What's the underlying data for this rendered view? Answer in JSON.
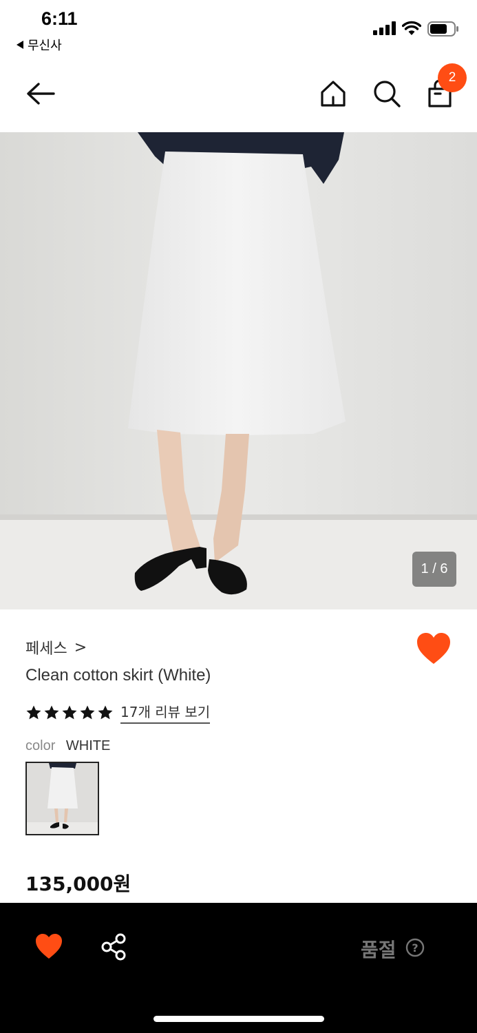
{
  "status_bar": {
    "time": "6:11",
    "back_app": "무신사"
  },
  "nav": {
    "cart_count": "2"
  },
  "gallery": {
    "counter": "1 / 6"
  },
  "product": {
    "brand": "페세스",
    "brand_chevron": ">",
    "name": "Clean cotton skirt (White)",
    "rating_stars": 5,
    "review_link": "17개 리뷰 보기",
    "color_label": "color",
    "color_value": "WHITE",
    "price": "135,000원"
  },
  "bottom_bar": {
    "status": "품절",
    "help_glyph": "?"
  },
  "colors": {
    "accent": "#ff4d14",
    "bottom_bar_bg": "#000000",
    "soldout_text": "#777777"
  },
  "icons": [
    "back-arrow-icon",
    "home-icon",
    "search-icon",
    "shopping-bag-icon",
    "heart-icon",
    "star-icon",
    "share-icon",
    "help-icon"
  ]
}
